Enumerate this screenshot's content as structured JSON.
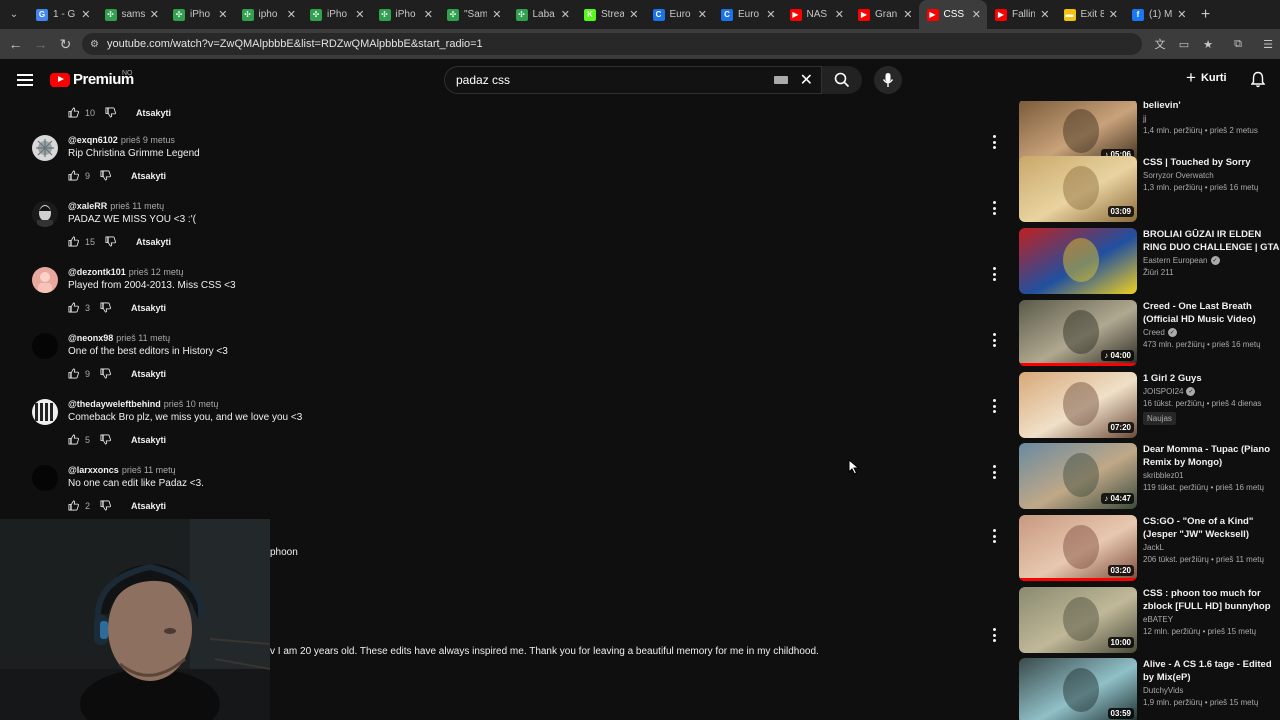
{
  "browser": {
    "tabs": [
      {
        "title": "1 - G",
        "fav_color": "#4285f4",
        "fav_glyph": "G",
        "active": false
      },
      {
        "title": "sams",
        "fav_color": "#30a14e",
        "fav_glyph": "✣",
        "active": false
      },
      {
        "title": "iPho",
        "fav_color": "#30a14e",
        "fav_glyph": "✣",
        "active": false
      },
      {
        "title": "ipho",
        "fav_color": "#30a14e",
        "fav_glyph": "✣",
        "active": false
      },
      {
        "title": "iPho",
        "fav_color": "#30a14e",
        "fav_glyph": "✣",
        "active": false
      },
      {
        "title": "iPho",
        "fav_color": "#30a14e",
        "fav_glyph": "✣",
        "active": false
      },
      {
        "title": "\"Sam",
        "fav_color": "#30a14e",
        "fav_glyph": "✣",
        "active": false
      },
      {
        "title": "Laba",
        "fav_color": "#30a14e",
        "fav_glyph": "✣",
        "active": false
      },
      {
        "title": "Strea",
        "fav_color": "#53fc18",
        "fav_glyph": "K",
        "active": false
      },
      {
        "title": "Euro",
        "fav_color": "#1a73e8",
        "fav_glyph": "C",
        "active": false
      },
      {
        "title": "Euro",
        "fav_color": "#1a73e8",
        "fav_glyph": "C",
        "active": false
      },
      {
        "title": "NAS",
        "fav_color": "#ff0000",
        "fav_glyph": "▶",
        "active": false
      },
      {
        "title": "Gran",
        "fav_color": "#ff0000",
        "fav_glyph": "▶",
        "active": false
      },
      {
        "title": "CSS",
        "fav_color": "#ff0000",
        "fav_glyph": "▶",
        "active": true
      },
      {
        "title": "Fallin",
        "fav_color": "#ff0000",
        "fav_glyph": "▶",
        "active": false
      },
      {
        "title": "Exit 8",
        "fav_color": "#f4c20d",
        "fav_glyph": "▬",
        "active": false
      },
      {
        "title": "(1) M",
        "fav_color": "#1877f2",
        "fav_glyph": "f",
        "active": false
      }
    ],
    "url": "youtube.com/watch?v=ZwQMAlpbbbE&list=RDZwQMAlpbbbE&start_radio=1"
  },
  "youtube": {
    "logo_text": "Premium",
    "logo_country": "NO",
    "search_query": "padaz css",
    "create_label": "Kurti"
  },
  "comments": {
    "top_likes": "10",
    "reply_label": "Atsakyti",
    "items": [
      {
        "author": "@exqn6102",
        "time": "prieš 9 metus",
        "text": "Rip Christina Grimme Legend",
        "likes": "9"
      },
      {
        "author": "@xaleRR",
        "time": "prieš 11 metų",
        "text": "PADAZ WE MISS YOU <3 :'(",
        "likes": "15"
      },
      {
        "author": "@dezontk101",
        "time": "prieš 12 metų",
        "text": "Played from 2004-2013. Miss CSS <3",
        "likes": "3"
      },
      {
        "author": "@neonx98",
        "time": "prieš 11 metų",
        "text": "One of the best editors in History <3",
        "likes": "9"
      },
      {
        "author": "@thedayweleftbehind",
        "time": "prieš 10 metų",
        "text": "Comeback Bro plz, we miss you,  and we love you <3",
        "likes": "5"
      },
      {
        "author": "@larxxoncs",
        "time": "prieš 11 metų",
        "text": "No one can edit like Padaz <3.",
        "likes": "2"
      }
    ],
    "partial_1": "phoon",
    "partial_2": "v I am 20 years old. These edits have always inspired me. Thank you for leaving a beautiful memory for me in my childhood."
  },
  "recommendations": [
    {
      "title": "believin'",
      "channel": "jj",
      "verified": false,
      "stats": "1,4 mln. peržiūrų • prieš 2 metus",
      "duration": "05:06",
      "music": true,
      "progress": 1.0,
      "thumb_colors": [
        "#7a5a3a",
        "#c8a27a",
        "#3a2a1a"
      ],
      "badge": ""
    },
    {
      "title": "CSS | Touched by Sorry",
      "channel": "Sorryzor Overwatch",
      "verified": false,
      "stats": "1,3 mln. peržiūrų • prieš 16 metų",
      "duration": "03:09",
      "music": false,
      "progress": 0,
      "thumb_colors": [
        "#c9a86a",
        "#e9d3a0",
        "#8a6a3a"
      ],
      "badge": ""
    },
    {
      "title": "BROLIAI GŪZAI IR ELDEN RING DUO CHALLENGE | GTA ...",
      "channel": "Eastern European",
      "verified": true,
      "stats": "Žiūri 211",
      "duration": "",
      "music": false,
      "progress": 0,
      "thumb_colors": [
        "#c02020",
        "#2050a0",
        "#f0d020"
      ],
      "badge": ""
    },
    {
      "title": "Creed - One Last Breath (Official HD Music Video)",
      "channel": "Creed",
      "verified": true,
      "stats": "473 mln. peržiūrų • prieš 16 metų",
      "duration": "04:00",
      "music": true,
      "progress": 1.0,
      "thumb_colors": [
        "#5a5a4a",
        "#b0a890",
        "#2a2a22"
      ],
      "badge": ""
    },
    {
      "title": "1 Girl 2 Guys",
      "channel": "JOISPOI24",
      "verified": true,
      "stats": "16 tūkst. peržiūrų • prieš 4 dienas",
      "duration": "07:20",
      "music": false,
      "progress": 0,
      "thumb_colors": [
        "#d8a878",
        "#f0e0c8",
        "#6a4a3a"
      ],
      "badge": "Naujas"
    },
    {
      "title": "Dear Momma - Tupac (Piano Remix by Mongo)",
      "channel": "skribblez01",
      "verified": false,
      "stats": "119 tūkst. peržiūrų • prieš 16 metų",
      "duration": "04:47",
      "music": true,
      "progress": 0,
      "thumb_colors": [
        "#6a8aa0",
        "#c0a888",
        "#3a4a3a"
      ],
      "badge": ""
    },
    {
      "title": "CS:GO - \"One of a Kind\" (Jesper \"JW\" Wecksell)",
      "channel": "JackL",
      "verified": false,
      "stats": "206 tūkst. peržiūrų • prieš 11 metų",
      "duration": "03:20",
      "music": false,
      "progress": 1.0,
      "thumb_colors": [
        "#c89880",
        "#e8c8b0",
        "#7a4a3a"
      ],
      "badge": ""
    },
    {
      "title": "CSS : phoon too much for zblock [FULL HD] bunnyhop ...",
      "channel": "eBATEY",
      "verified": false,
      "stats": "12 mln. peržiūrų • prieš 15 metų",
      "duration": "10:00",
      "music": false,
      "progress": 0,
      "thumb_colors": [
        "#8a8a70",
        "#c0b898",
        "#4a4a3a"
      ],
      "badge": ""
    },
    {
      "title": "Alive - A CS 1.6 tage - Edited by Mix(eP)",
      "channel": "DutchyVids",
      "verified": false,
      "stats": "1,9 mln. peržiūrų • prieš 15 metų",
      "duration": "03:59",
      "music": false,
      "progress": 0,
      "thumb_colors": [
        "#3a4a4a",
        "#90c0c8",
        "#1a2a2a"
      ],
      "badge": ""
    }
  ],
  "icons": {
    "like": "thumbs-up-icon",
    "dislike": "thumbs-down-icon",
    "more": "more-vert-icon",
    "search": "search-icon",
    "mic": "mic-icon",
    "bell": "bell-icon"
  }
}
